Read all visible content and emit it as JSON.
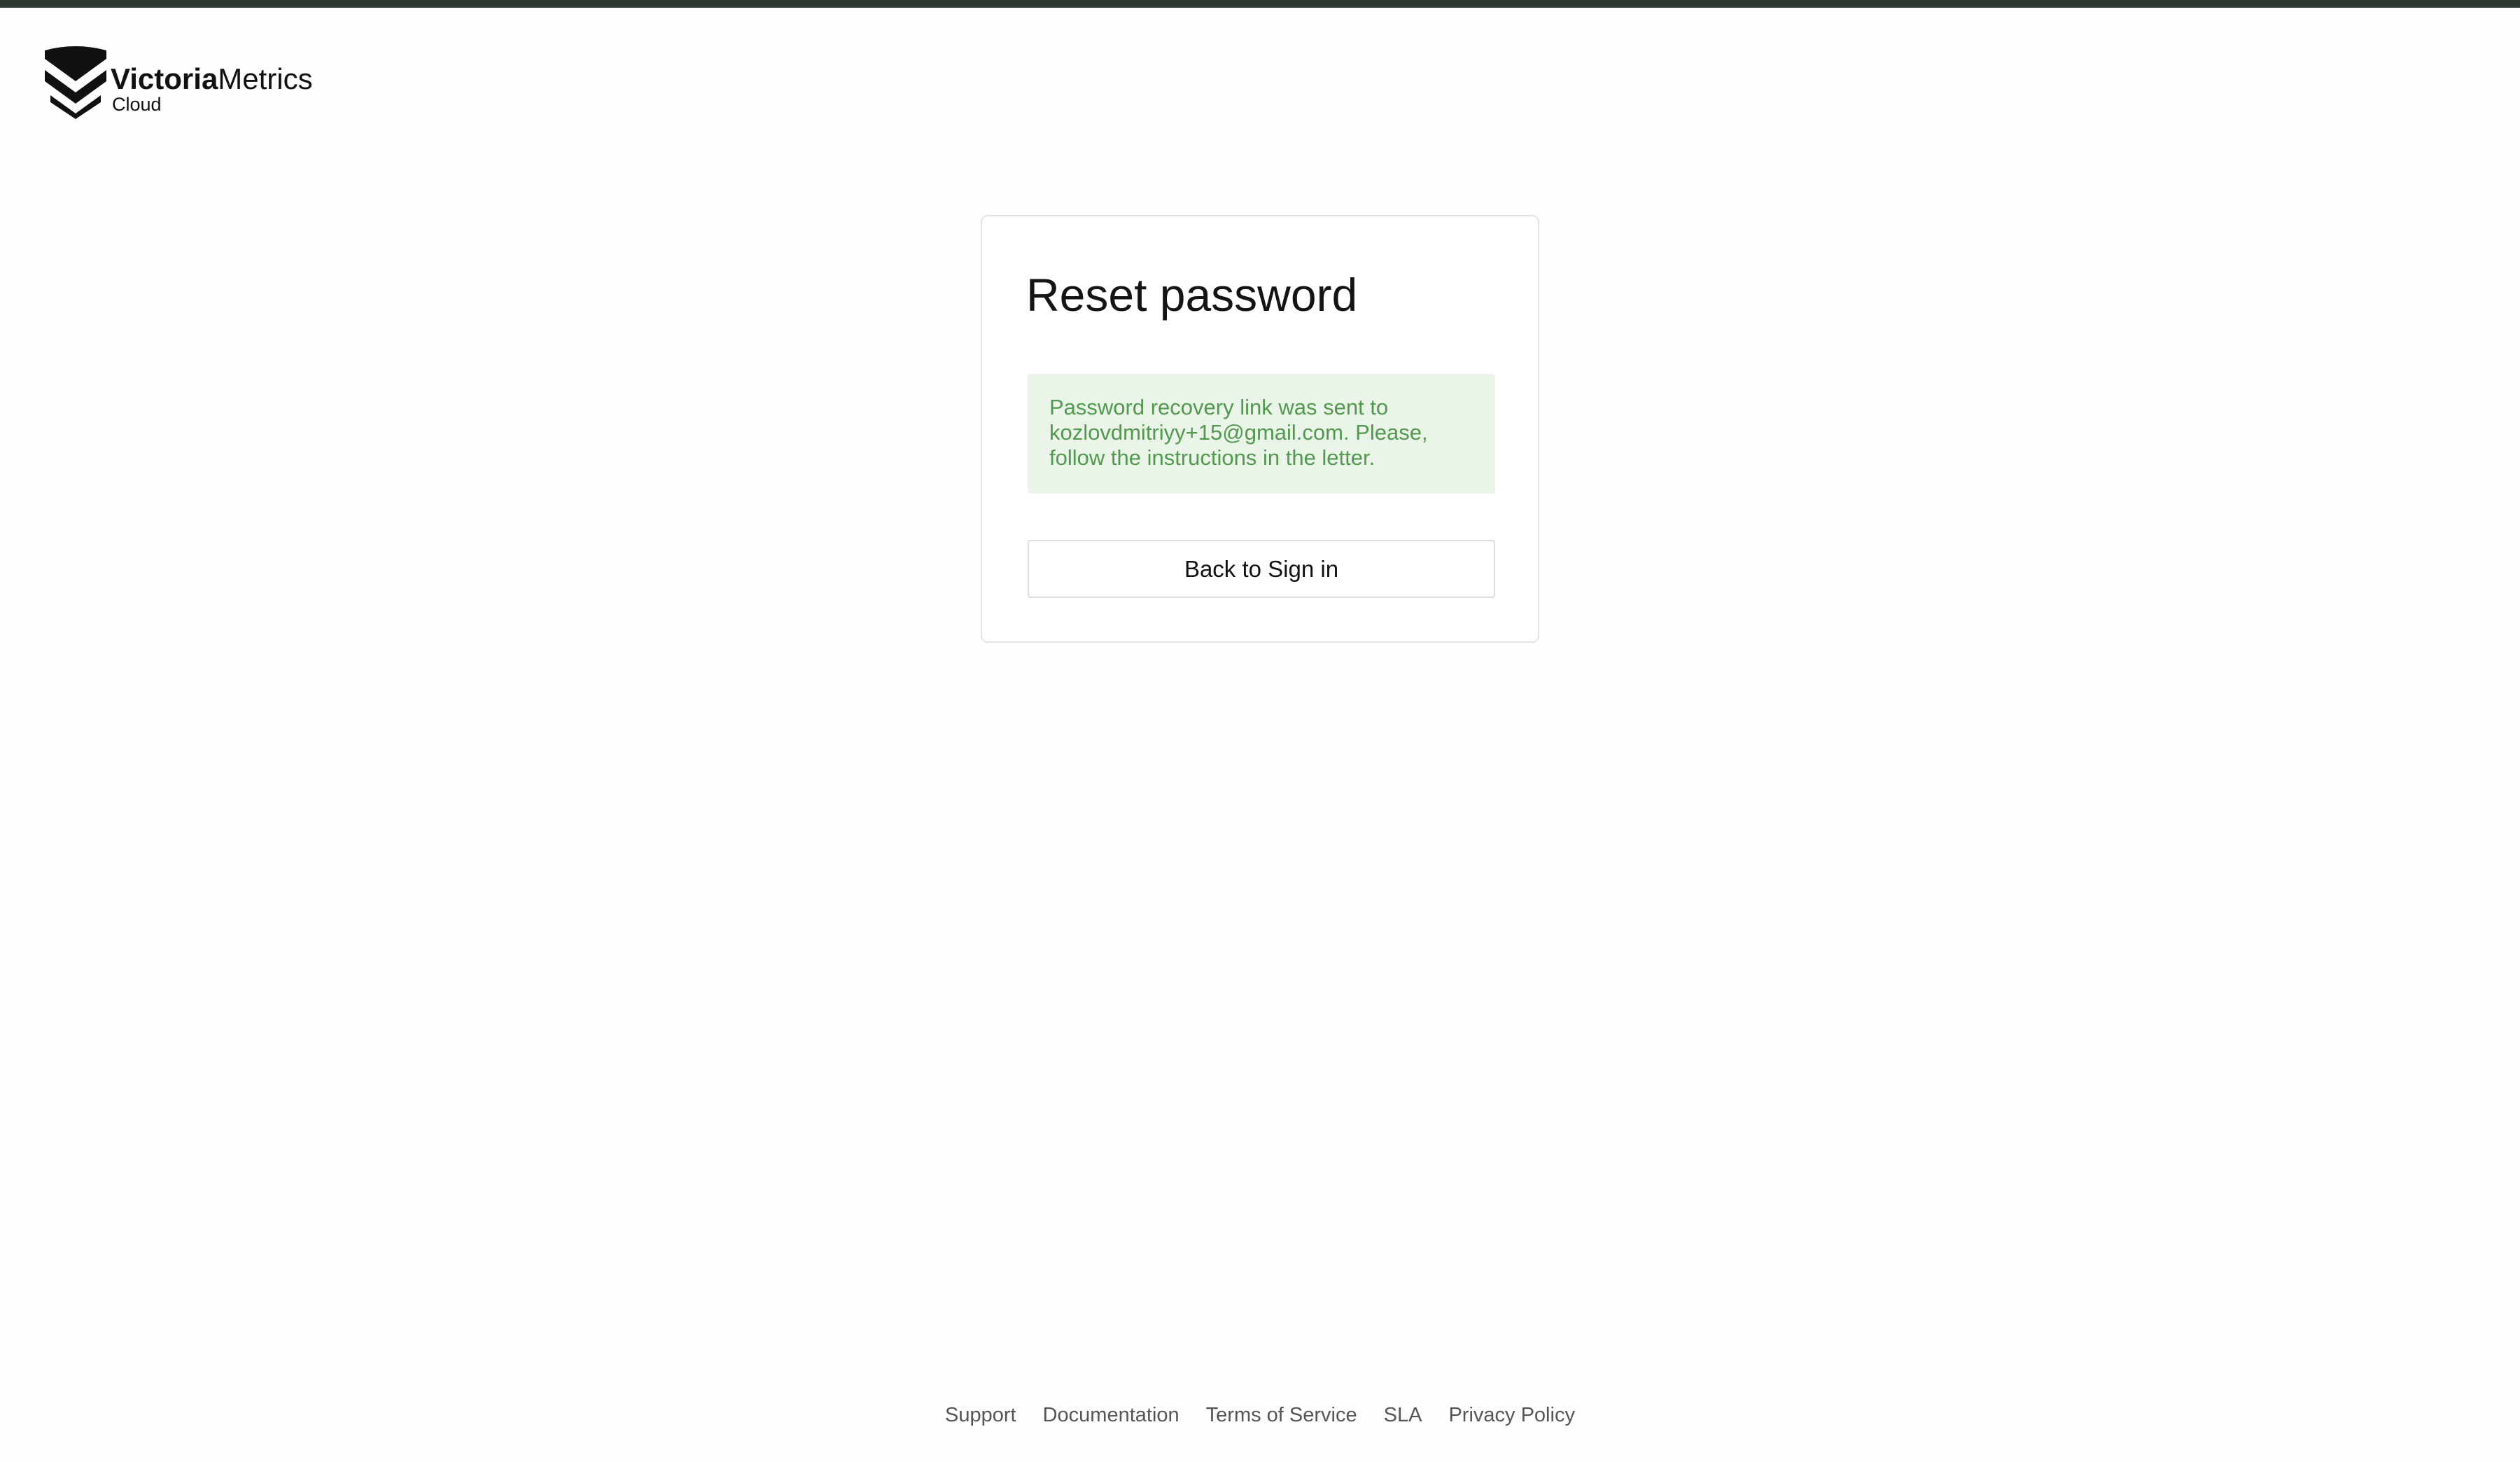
{
  "logo": {
    "brand_bold": "Victoria",
    "brand_regular": "Metrics",
    "product": "Cloud"
  },
  "card": {
    "title": "Reset password",
    "alert_message": "Password recovery link was sent to kozlovdmitriyy+15@gmail.com. Please, follow the instructions in the letter.",
    "back_button_label": "Back to Sign in"
  },
  "footer": {
    "links": [
      "Support",
      "Documentation",
      "Terms of Service",
      "SLA",
      "Privacy Policy"
    ]
  },
  "colors": {
    "top_bar": "#2e3a2f",
    "alert_background": "#ebf4e9",
    "alert_text": "#4f9a4d",
    "card_border": "#e3e3e3"
  },
  "icons": {
    "logo_mark": "victoriametrics-chevron-shield-icon"
  }
}
